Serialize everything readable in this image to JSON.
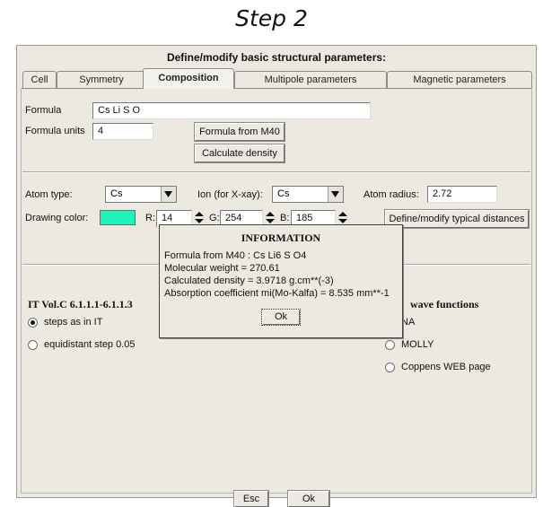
{
  "caption": "Step 2",
  "window": {
    "title": "Define/modify basic structural parameters:",
    "tabs": [
      {
        "label": "Cell"
      },
      {
        "label": "Symmetry"
      },
      {
        "label": "Composition"
      },
      {
        "label": "Multipole parameters"
      },
      {
        "label": "Magnetic parameters"
      }
    ],
    "active_tab": "Composition"
  },
  "composition": {
    "formula_label": "Formula",
    "formula_value": "Cs Li S O",
    "formula_units_label": "Formula units",
    "formula_units_value": "4",
    "formula_from_m40_button": "Formula from M40",
    "calculate_density_button": "Calculate density"
  },
  "atoms": {
    "atom_type_label": "Atom type:",
    "atom_type_value": "Cs",
    "ion_label": "Ion (for X-xay):",
    "ion_value": "Cs",
    "atom_radius_label": "Atom radius:",
    "atom_radius_value": "2.72",
    "drawing_color_label": "Drawing color:",
    "drawing_color": "#1ef6b9",
    "r_label": "R:",
    "r_value": "14",
    "g_label": "G:",
    "g_value": "254",
    "b_label": "B:",
    "b_value": "185",
    "typical_distances_button": "Define/modify typical distances"
  },
  "itvol": {
    "heading": "IT Vol.C 6.1.1.1-6.1.1.3",
    "option_steps": "steps as in IT",
    "option_equidistant": "equidistant step 0.05",
    "selected": "steps as in IT"
  },
  "wave": {
    "heading": "wave functions",
    "option_na": "NA",
    "option_molly": "MOLLY",
    "option_coppens": "Coppens WEB page"
  },
  "dialog": {
    "title": "INFORMATION",
    "line1": "Formula from M40 : Cs Li6 S O4",
    "line2": "Molecular weight =  270.61",
    "line3": "Calculated density =  3.9718 g.cm**(-3)",
    "line4": "Absorption coefficient mi(Mo-Kalfa) =   8.535 mm**-1",
    "ok_button": "Ok"
  },
  "footer": {
    "esc_button": "Esc",
    "ok_button": "Ok"
  }
}
